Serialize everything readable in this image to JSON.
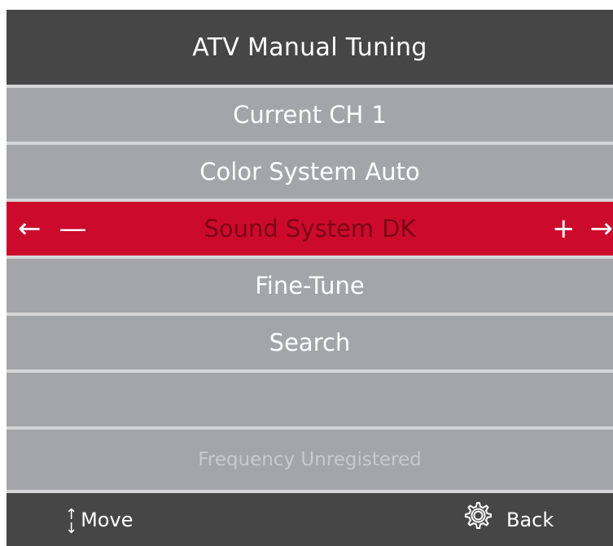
{
  "header": {
    "title": "ATV Manual Tuning"
  },
  "menu": {
    "current_ch": {
      "label": "Current CH",
      "value": "1"
    },
    "color_system": {
      "label": "Color System",
      "value": "Auto"
    },
    "sound_system": {
      "label": "Sound System",
      "value": "DK",
      "left_arrow": "←",
      "minus": "—",
      "plus": "+",
      "right_arrow": "→"
    },
    "fine_tune": {
      "label": "Fine-Tune"
    },
    "search": {
      "label": "Search"
    },
    "empty_row": {
      "label": ""
    },
    "status": {
      "label": "Frequency Unregistered"
    }
  },
  "footer": {
    "move": {
      "icon_up": "↑",
      "icon_down": "↓",
      "label": "Move"
    },
    "back": {
      "label": "Back"
    }
  },
  "colors": {
    "header_bg": "#464646",
    "row_bg": "#a4a5a9",
    "divider": "#d6d6d8",
    "selected_bg": "#cc0a2c",
    "selected_text": "#7a0516",
    "status_text": "#c9cacc"
  },
  "icons": {
    "move": "up-down-arrows-icon",
    "back": "gear-icon"
  }
}
